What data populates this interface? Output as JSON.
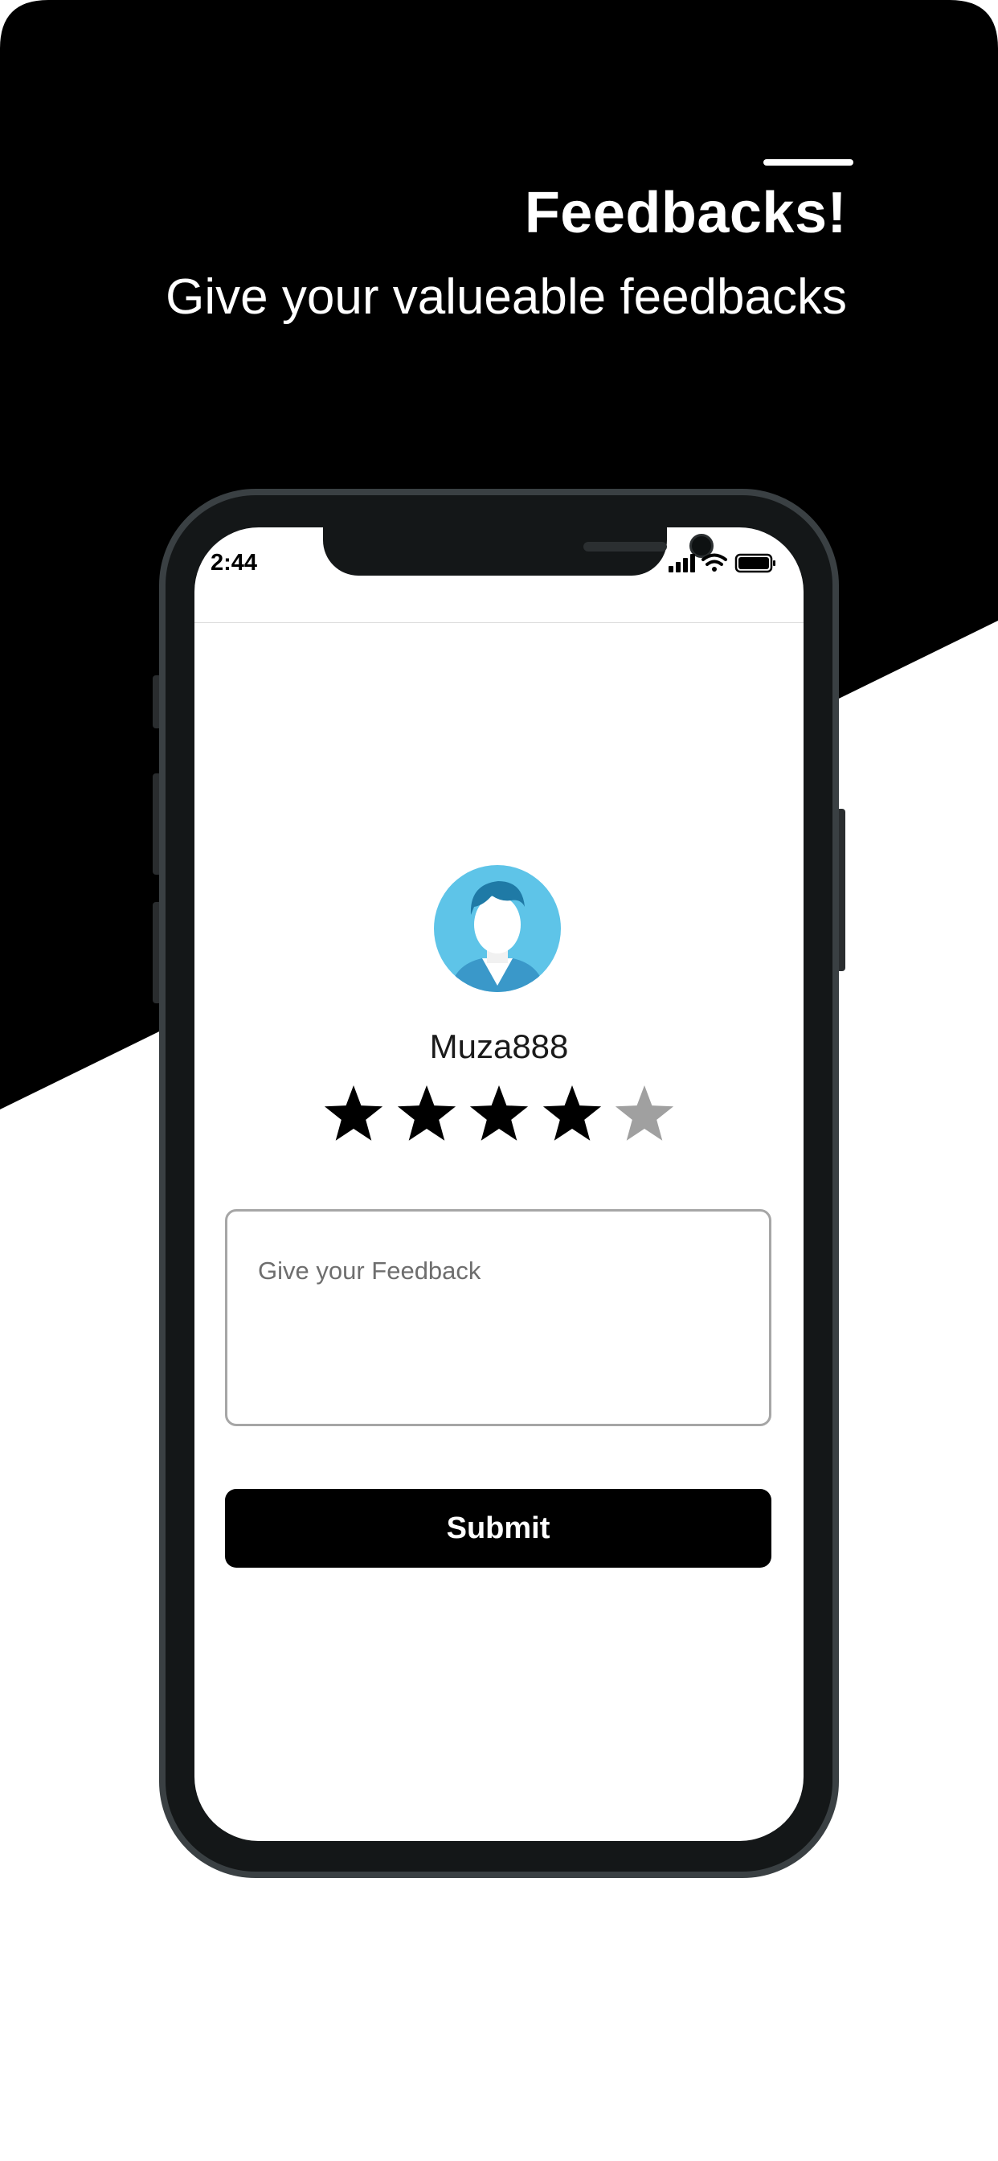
{
  "header": {
    "title": "Feedbacks!",
    "subtitle": "Give your valueable feedbacks"
  },
  "status_bar": {
    "time": "2:44",
    "icons": [
      "cellular-signal-icon",
      "wifi-icon",
      "battery-icon"
    ]
  },
  "profile": {
    "username": "Muza888",
    "avatar_icon": "user-avatar-icon"
  },
  "rating": {
    "value": 4,
    "max": 5,
    "filled_color": "#000000",
    "empty_color": "#a0a0a0"
  },
  "feedback": {
    "placeholder": "Give your Feedback"
  },
  "actions": {
    "submit_label": "Submit"
  },
  "colors": {
    "background_dark": "#000000",
    "background_light": "#ffffff",
    "avatar_circle": "#5ec4e8",
    "avatar_hair": "#1f7aa6"
  }
}
